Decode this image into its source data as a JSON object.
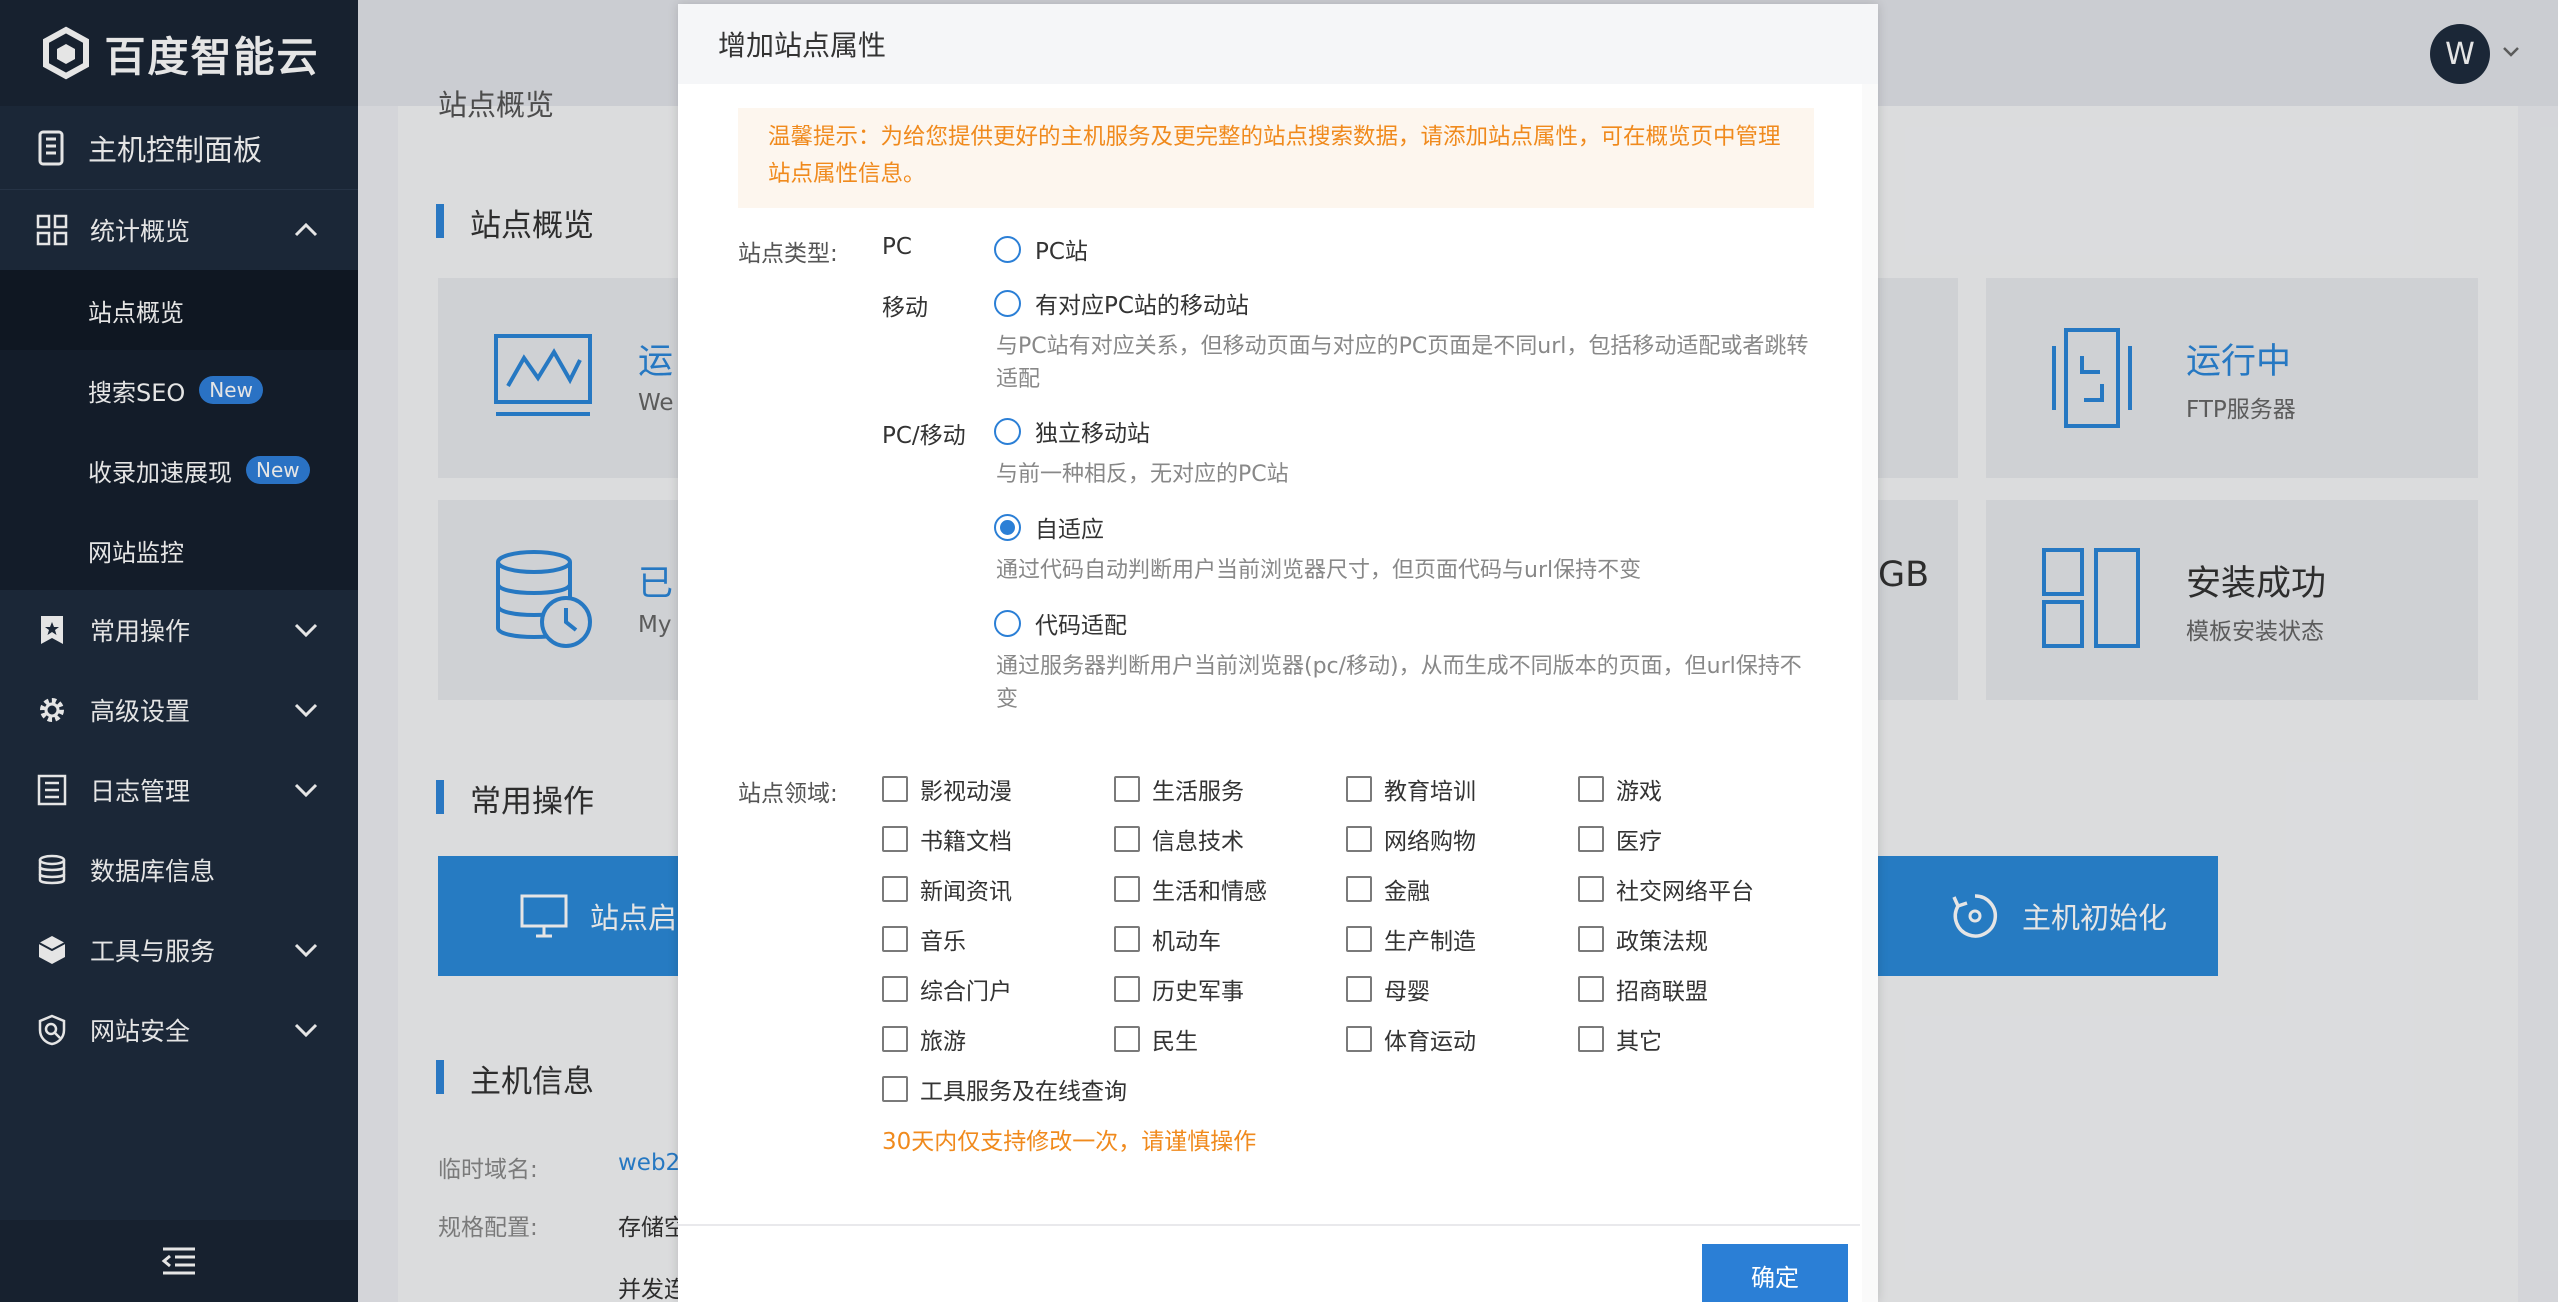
{
  "sidebar": {
    "logo_text": "百度智能云",
    "top_item": "主机控制面板",
    "groups": [
      {
        "label": "统计概览",
        "expanded": true,
        "icon": "grid-icon"
      },
      {
        "label": "常用操作",
        "expanded": false,
        "icon": "star-bookmark-icon"
      },
      {
        "label": "高级设置",
        "expanded": false,
        "icon": "gear-icon"
      },
      {
        "label": "日志管理",
        "expanded": false,
        "icon": "log-list-icon"
      },
      {
        "label": "数据库信息",
        "expanded": false,
        "icon": "database-icon"
      },
      {
        "label": "工具与服务",
        "expanded": false,
        "icon": "cube-icon"
      },
      {
        "label": "网站安全",
        "expanded": false,
        "icon": "shield-search-icon"
      }
    ],
    "sub_items": [
      {
        "label": "站点概览",
        "active": true
      },
      {
        "label": "搜索SEO",
        "badge": "New"
      },
      {
        "label": "收录加速展现",
        "badge": "New"
      },
      {
        "label": "网站监控"
      }
    ]
  },
  "header": {
    "avatar_letter": "W"
  },
  "background": {
    "crumb": "站点概览",
    "section_overview": "站点概览",
    "card1_title": "运",
    "card1_sub": "We",
    "card2_title": "运行中",
    "card2_sub": "FTP服务器",
    "card3_title": "已",
    "card3_sub": "My",
    "card4_partial": "GB",
    "card5_title": "安装成功",
    "card5_sub": "模板安装状态",
    "section_ops": "常用操作",
    "op1": "站点启",
    "op2": "主机初始化",
    "section_host": "主机信息",
    "host_label1": "临时域名:",
    "host_val1": "web2",
    "host_label2": "规格配置:",
    "host_val2": "存储空",
    "host_val3": "并发连"
  },
  "modal": {
    "title": "增加站点属性",
    "tip": "温馨提示：为给您提供更好的主机服务及更完整的站点搜索数据，请添加站点属性，可在概览页中管理站点属性信息。",
    "type_label": "站点类型:",
    "groups": {
      "pc": "PC",
      "mobile": "移动",
      "pcmobile": "PC/移动"
    },
    "options": [
      {
        "label": "PC站",
        "checked": false
      },
      {
        "label": "有对应PC站的移动站",
        "checked": false,
        "desc": "与PC站有对应关系，但移动页面与对应的PC页面是不同url，包括移动适配或者跳转适配"
      },
      {
        "label": "独立移动站",
        "checked": false,
        "desc": "与前一种相反，无对应的PC站"
      },
      {
        "label": "自适应",
        "checked": true,
        "desc": "通过代码自动判断用户当前浏览器尺寸，但页面代码与url保持不变"
      },
      {
        "label": "代码适配",
        "checked": false,
        "desc": "通过服务器判断用户当前浏览器(pc/移动)，从而生成不同版本的页面，但url保持不变"
      }
    ],
    "domain_label": "站点领域:",
    "domains": [
      "影视动漫",
      "生活服务",
      "教育培训",
      "游戏",
      "书籍文档",
      "信息技术",
      "网络购物",
      "医疗",
      "新闻资讯",
      "生活和情感",
      "金融",
      "社交网络平台",
      "音乐",
      "机动车",
      "生产制造",
      "政策法规",
      "综合门户",
      "历史军事",
      "母婴",
      "招商联盟",
      "旅游",
      "民生",
      "体育运动",
      "其它",
      "工具服务及在线查询"
    ],
    "warning": "30天内仅支持修改一次，请谨慎操作",
    "confirm": "确定"
  },
  "colors": {
    "sidebar_bg": "#1f2c3e",
    "accent": "#2b7fd6",
    "warning": "#f08a1d"
  }
}
